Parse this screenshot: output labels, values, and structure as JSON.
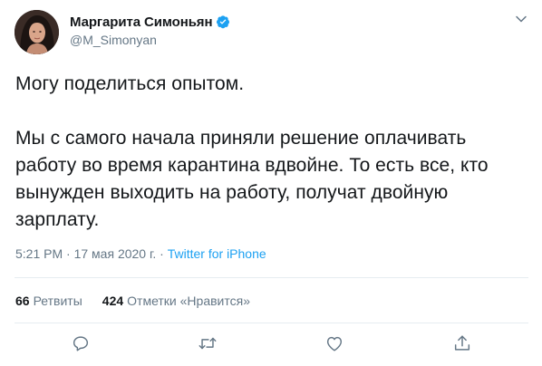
{
  "author": {
    "display_name": "Маргарита Симоньян",
    "handle": "@M_Simonyan",
    "verified": true,
    "avatar_icon": "profile-photo"
  },
  "tweet": {
    "paragraphs": [
      "Могу поделиться опытом.",
      "Мы с самого начала приняли решение оплачивать работу во время карантина вдвойне. То есть все, кто вынужден выходить на работу, получат двойную зарплату."
    ]
  },
  "meta": {
    "time": "5:21 PM",
    "separator": " · ",
    "date": "17 мая 2020 г.",
    "source": "Twitter for iPhone"
  },
  "stats": {
    "retweets_count": "66",
    "retweets_label": "Ретвиты",
    "likes_count": "424",
    "likes_label": "Отметки «Нравится»"
  },
  "actions": {
    "icons": [
      "reply-icon",
      "retweet-icon",
      "like-icon",
      "share-icon"
    ]
  },
  "colors": {
    "text": "#14171a",
    "secondary": "#657786",
    "accent": "#1da1f2",
    "divider": "#e6ecf0"
  }
}
